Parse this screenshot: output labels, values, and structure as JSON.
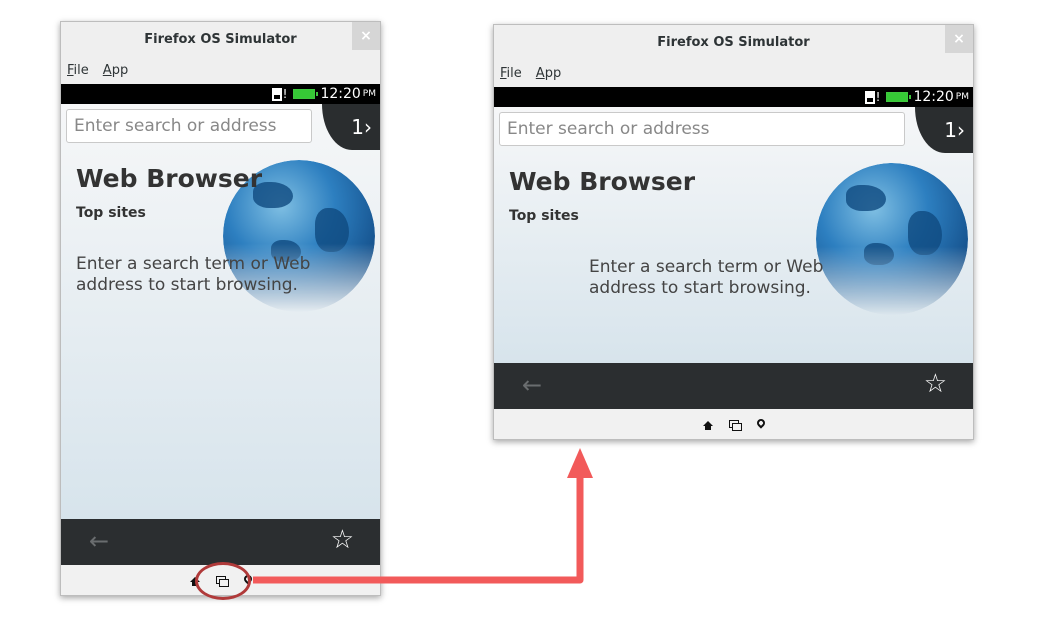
{
  "window_title": "Firefox OS Simulator",
  "close_glyph": "×",
  "menu": {
    "file": "File",
    "app": "App"
  },
  "status": {
    "time": "12:20",
    "ampm": "PM",
    "battery_color": "#36c936"
  },
  "browser": {
    "search_placeholder": "Enter search or address",
    "tab_count": "1›",
    "heading": "Web Browser",
    "top_sites": "Top sites",
    "message": "Enter a search term or Web address to start browsing."
  },
  "toolbar": {
    "back_glyph": "←",
    "star_glyph": "☆"
  },
  "homebar_icons": [
    "home-icon",
    "cards-icon",
    "location-pin-icon"
  ],
  "annotation": {
    "color": "#f25a5a",
    "ring_color": "#b03a3a"
  }
}
